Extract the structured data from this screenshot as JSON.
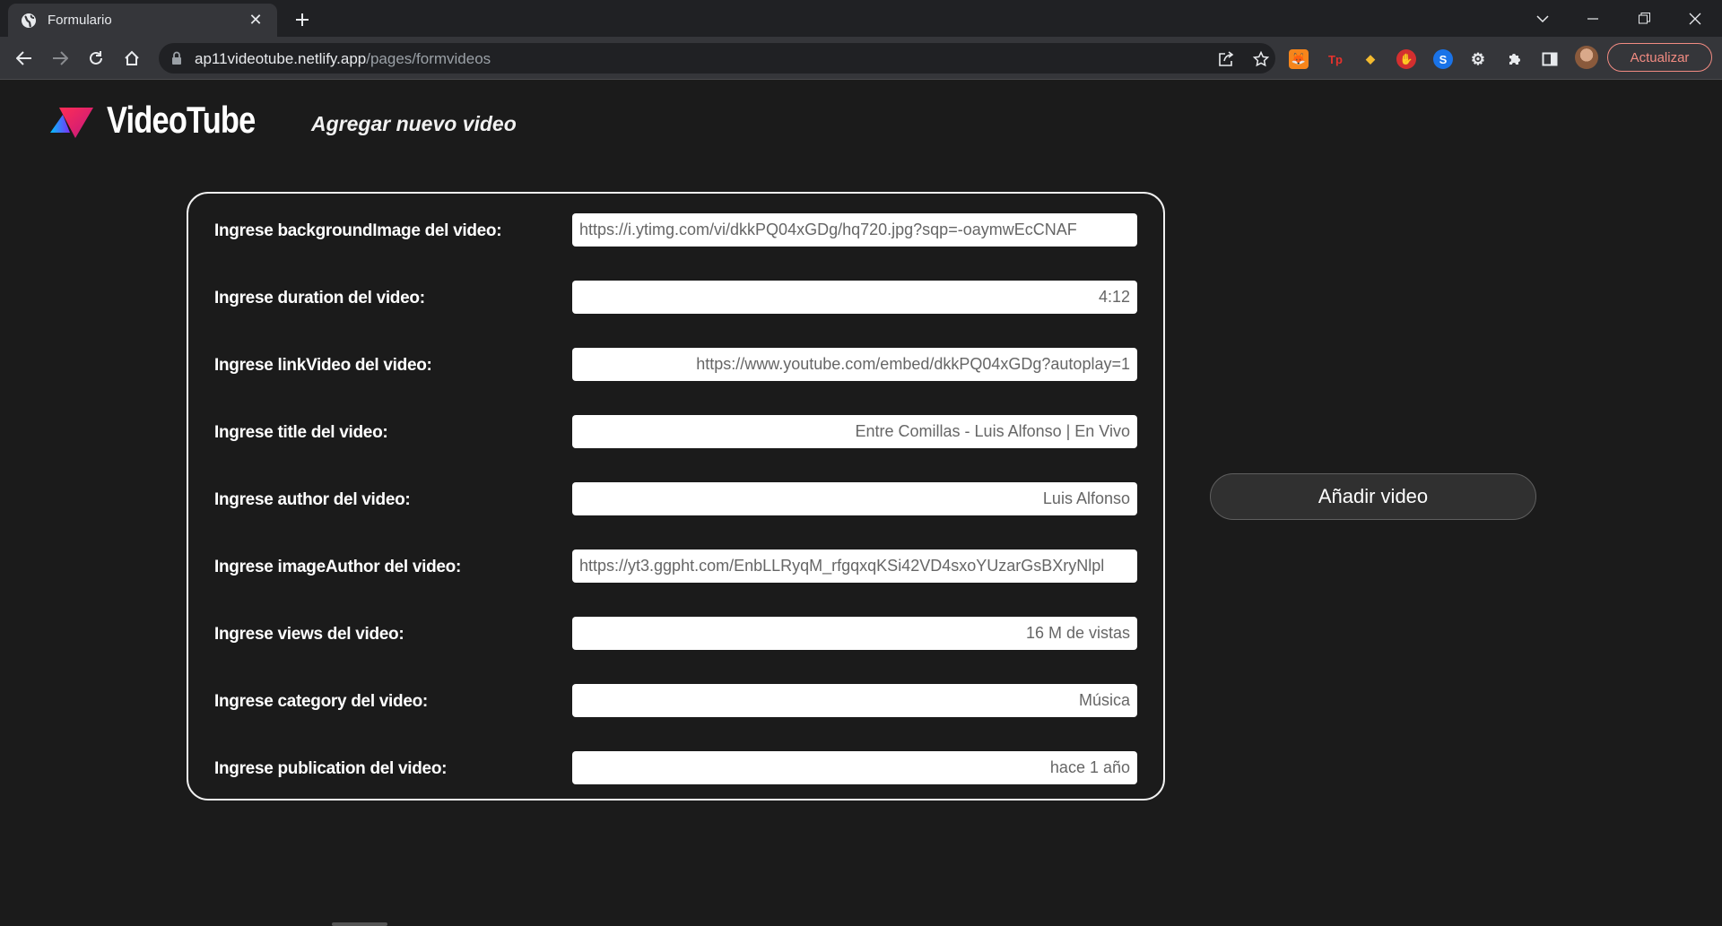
{
  "browser": {
    "tab_title": "Formulario",
    "url_host": "ap11videotube.netlify.app",
    "url_path": "/pages/formvideos",
    "update_label": "Actualizar",
    "accent_color": "#f28b82"
  },
  "header": {
    "brand": "VideoTube",
    "subtitle": "Agregar nuevo video"
  },
  "form": {
    "fields": [
      {
        "label": "Ingrese backgroundImage del video:",
        "value": "https://i.ytimg.com/vi/dkkPQ04xGDg/hq720.jpg?sqp=-oaymwEcCNAF"
      },
      {
        "label": "Ingrese duration del video:",
        "value": "4:12"
      },
      {
        "label": "Ingrese linkVideo del video:",
        "value": "https://www.youtube.com/embed/dkkPQ04xGDg?autoplay=1"
      },
      {
        "label": "Ingrese title del video:",
        "value": "Entre Comillas - Luis Alfonso | En Vivo"
      },
      {
        "label": "Ingrese author del video:",
        "value": "Luis Alfonso"
      },
      {
        "label": "Ingrese imageAuthor del video:",
        "value": "https://yt3.ggpht.com/EnbLLRyqM_rfgqxqKSi42VD4sxoYUzarGsBXryNlpl"
      },
      {
        "label": "Ingrese views del video:",
        "value": "16 M de vistas"
      },
      {
        "label": "Ingrese category del video:",
        "value": "Música"
      },
      {
        "label": "Ingrese publication del video:",
        "value": "hace 1 año"
      }
    ],
    "submit_label": "Añadir video"
  },
  "icons": {
    "tab_favicon": "globe-icon",
    "extensions": [
      "metamask-icon",
      "tp-icon",
      "cube-icon",
      "hand-stop-icon",
      "shazam-icon",
      "gear-icon",
      "puzzle-icon",
      "sidepanel-icon"
    ]
  }
}
